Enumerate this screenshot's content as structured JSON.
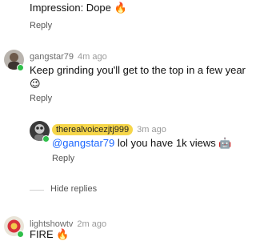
{
  "comments": [
    {
      "text": "Impression: Dope",
      "emoji": "🔥",
      "reply_label": "Reply"
    },
    {
      "username": "gangstar79",
      "time": "4m ago",
      "text": "Keep grinding you'll get to the top in a few year",
      "emoji": "😉",
      "reply_label": "Reply"
    },
    {
      "username": "therealvoicezjtj999",
      "time": "3m ago",
      "mention": "@gangstar79",
      "text": " lol you have 1k views ",
      "emoji": "🤖",
      "reply_label": "Reply"
    },
    {
      "username": "lightshowtv",
      "time": "2m ago",
      "text": "FIRE",
      "emoji": "🔥"
    }
  ],
  "hide_replies_label": "Hide replies",
  "colors": {
    "online": "#2fbf4a",
    "mention": "#1b66ff",
    "highlight": "#f6d64a"
  }
}
